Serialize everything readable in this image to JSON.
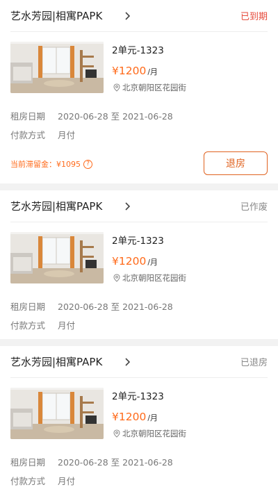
{
  "orders": [
    {
      "property_name": "艺水芳园|相寓PAPK",
      "status": "已到期",
      "status_color": "#e64a3b",
      "unit": "2单元-1323",
      "price": "¥1200",
      "price_unit": "/月",
      "address": "北京朝阳区花园街",
      "rent_period_label": "租房日期",
      "rent_period": "2020-06-28 至 2021-06-28",
      "payment_label": "付款方式",
      "payment": "月付",
      "deposit_text": "当前滞留金：¥1095",
      "deposit_help_icon": "?",
      "action_label": "退房"
    },
    {
      "property_name": "艺水芳园|相寓PAPK",
      "status": "已作废",
      "status_color": "#888888",
      "unit": "2单元-1323",
      "price": "¥1200",
      "price_unit": "/月",
      "address": "北京朝阳区花园街",
      "rent_period_label": "租房日期",
      "rent_period": "2020-06-28 至 2021-06-28",
      "payment_label": "付款方式",
      "payment": "月付"
    },
    {
      "property_name": "艺水芳园|相寓PAPK",
      "status": "已退房",
      "status_color": "#888888",
      "unit": "2单元-1323",
      "price": "¥1200",
      "price_unit": "/月",
      "address": "北京朝阳区花园街",
      "rent_period_label": "租房日期",
      "rent_period": "2020-06-28 至 2021-06-28",
      "payment_label": "付款方式",
      "payment": "月付"
    }
  ],
  "accent_color": "#ff6a1a",
  "icons": [
    "chevron-right-icon",
    "location-pin-icon",
    "question-circle-icon"
  ]
}
